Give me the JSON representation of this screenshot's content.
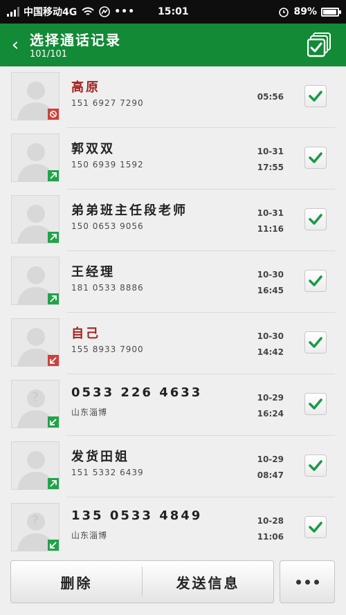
{
  "status_bar": {
    "carrier": "中国移动4G",
    "time": "15:01",
    "battery": "89%"
  },
  "header": {
    "title": "选择通话记录",
    "count": "101/101"
  },
  "contacts": [
    {
      "name": "高原",
      "number": "151 6927 7290",
      "date": "",
      "time": "05:56",
      "call_type": "blocked"
    },
    {
      "name": "郭双双",
      "number": "150 6939 1592",
      "date": "10-31",
      "time": "17:55",
      "call_type": "outgoing"
    },
    {
      "name": "弟弟班主任段老师",
      "number": "150 0653 9056",
      "date": "10-31",
      "time": "11:16",
      "call_type": "outgoing"
    },
    {
      "name": "王经理",
      "number": "181 0533 8886",
      "date": "10-30",
      "time": "16:45",
      "call_type": "outgoing"
    },
    {
      "name": "自己",
      "number": "155 8933 7900",
      "date": "10-30",
      "time": "14:42",
      "call_type": "missed"
    },
    {
      "name": "0533 226 4633",
      "number": "山东淄博",
      "date": "10-29",
      "time": "16:24",
      "call_type": "incoming"
    },
    {
      "name": "发货田姐",
      "number": "151 5332 6439",
      "date": "10-29",
      "time": "08:47",
      "call_type": "outgoing"
    },
    {
      "name": "135 0533 4849",
      "number": "山东淄博",
      "date": "10-28",
      "time": "11:06",
      "call_type": "incoming"
    }
  ],
  "actions": {
    "delete": "删除",
    "send": "发送信息"
  },
  "colors": {
    "header": "#138a36",
    "check": "#1a9a47",
    "missed": "#c9423b"
  }
}
